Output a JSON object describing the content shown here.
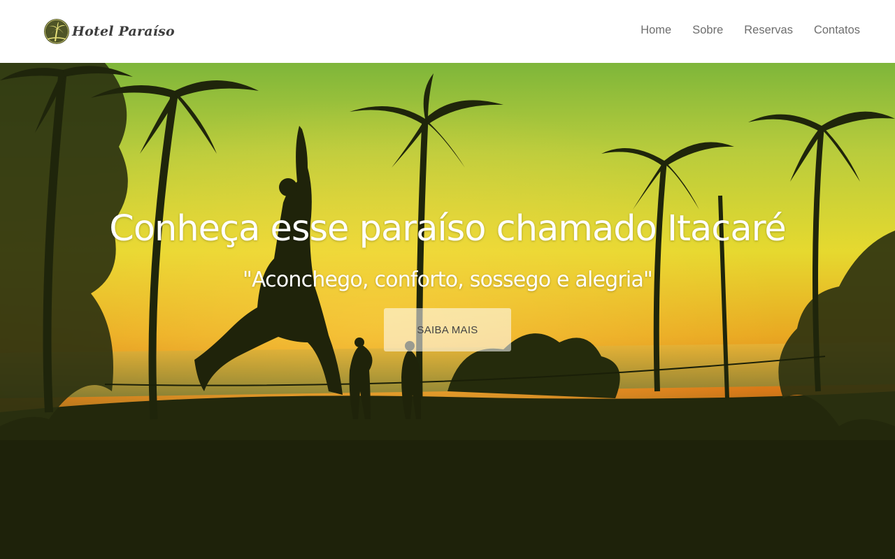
{
  "header": {
    "logo_text": "Hotel Paraíso",
    "logo_icon": "palm-tree-icon",
    "nav": [
      {
        "label": "Home"
      },
      {
        "label": "Sobre"
      },
      {
        "label": "Reservas"
      },
      {
        "label": "Contatos"
      }
    ]
  },
  "hero": {
    "title": "Conheça esse paraíso chamado Itacaré",
    "subtitle": "\"Aconchego, conforto, sossego e alegria\"",
    "button_label": "SAIBA MAIS"
  },
  "colors": {
    "nav_text": "#6e6e6e",
    "logo_badge": "#4f5527",
    "sky_yellow": "#e8d832",
    "sunset_orange": "#e28a1c",
    "ground_dark": "#1e220a"
  }
}
